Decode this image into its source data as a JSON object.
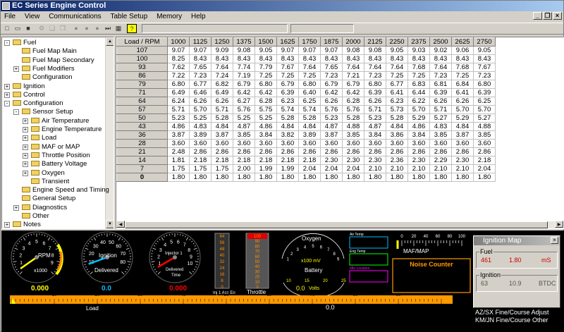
{
  "window": {
    "title": "EC Series Engine Control"
  },
  "menu": [
    "File",
    "View",
    "Communications",
    "Table Setup",
    "Memory",
    "Help"
  ],
  "tree": [
    {
      "label": "Fuel",
      "level": 0,
      "exp": "-"
    },
    {
      "label": "Fuel Map Main",
      "level": 1
    },
    {
      "label": "Fuel Map Secondary",
      "level": 1
    },
    {
      "label": "Fuel Modifiers",
      "level": 1,
      "exp": "+"
    },
    {
      "label": "Configuration",
      "level": 1
    },
    {
      "label": "Ignition",
      "level": 0,
      "exp": "+"
    },
    {
      "label": "Control",
      "level": 0,
      "exp": "+"
    },
    {
      "label": "Configuration",
      "level": 0,
      "exp": "-"
    },
    {
      "label": "Sensor Setup",
      "level": 1,
      "exp": "-"
    },
    {
      "label": "Air Temperature",
      "level": 2,
      "exp": "+"
    },
    {
      "label": "Engine Temperature",
      "level": 2,
      "exp": "+"
    },
    {
      "label": "Load",
      "level": 2,
      "exp": "+"
    },
    {
      "label": "MAF or MAP",
      "level": 2,
      "exp": "+"
    },
    {
      "label": "Throttle Position",
      "level": 2,
      "exp": "+"
    },
    {
      "label": "Battery Voltage",
      "level": 2,
      "exp": "+"
    },
    {
      "label": "Oxygen",
      "level": 2,
      "exp": "+"
    },
    {
      "label": "Transient",
      "level": 2
    },
    {
      "label": "Engine Speed and Timing",
      "level": 1
    },
    {
      "label": "General Setup",
      "level": 1
    },
    {
      "label": "Diagnostics",
      "level": 1,
      "exp": "+"
    },
    {
      "label": "Other",
      "level": 1
    },
    {
      "label": "Notes",
      "level": 0,
      "exp": "+"
    }
  ],
  "table": {
    "corner": "Load / RPM",
    "rpm": [
      "1000",
      "1125",
      "1250",
      "1375",
      "1500",
      "1625",
      "1750",
      "1875",
      "2000",
      "2125",
      "2250",
      "2375",
      "2500",
      "2625",
      "2750"
    ],
    "rows": [
      {
        "load": "107",
        "v": [
          "9.07",
          "9.07",
          "9.09",
          "9.08",
          "9.05",
          "9.07",
          "9.07",
          "9.07",
          "9.08",
          "9.08",
          "9.05",
          "9.03",
          "9.02",
          "9.06",
          "9.05"
        ]
      },
      {
        "load": "100",
        "v": [
          "8.25",
          "8.43",
          "8.43",
          "8.43",
          "8.43",
          "8.43",
          "8.43",
          "8.43",
          "8.43",
          "8.43",
          "8.43",
          "8.43",
          "8.43",
          "8.43",
          "8.43"
        ]
      },
      {
        "load": "93",
        "v": [
          "7.62",
          "7.65",
          "7.64",
          "7.74",
          "7.79",
          "7.67",
          "7.64",
          "7.65",
          "7.64",
          "7.64",
          "7.64",
          "7.68",
          "7.64",
          "7.68",
          "7.67"
        ]
      },
      {
        "load": "86",
        "v": [
          "7.22",
          "7.23",
          "7.24",
          "7.19",
          "7.25",
          "7.25",
          "7.25",
          "7.23",
          "7.21",
          "7.23",
          "7.25",
          "7.25",
          "7.23",
          "7.25",
          "7.23"
        ]
      },
      {
        "load": "79",
        "v": [
          "6.80",
          "6.77",
          "6.82",
          "6.79",
          "6.80",
          "6.79",
          "6.80",
          "6.79",
          "6.79",
          "6.80",
          "6.77",
          "6.83",
          "6.81",
          "6.84",
          "6.80"
        ]
      },
      {
        "load": "71",
        "v": [
          "6.49",
          "6.46",
          "6.49",
          "6.42",
          "6.42",
          "6.39",
          "6.40",
          "6.42",
          "6.42",
          "6.39",
          "6.41",
          "6.44",
          "6.39",
          "6.41",
          "6.39"
        ]
      },
      {
        "load": "64",
        "v": [
          "6.24",
          "6.26",
          "6.26",
          "6.27",
          "6.28",
          "6.23",
          "6.25",
          "6.26",
          "6.28",
          "6.26",
          "6.23",
          "6.22",
          "6.26",
          "6.26",
          "6.25"
        ]
      },
      {
        "load": "57",
        "v": [
          "5.71",
          "5.70",
          "5.71",
          "5.76",
          "5.75",
          "5.74",
          "5.74",
          "5.76",
          "5.76",
          "5.71",
          "5.73",
          "5.70",
          "5.71",
          "5.70",
          "5.70"
        ]
      },
      {
        "load": "50",
        "v": [
          "5.23",
          "5.25",
          "5.28",
          "5.25",
          "5.25",
          "5.28",
          "5.28",
          "5.23",
          "5.28",
          "5.23",
          "5.28",
          "5.29",
          "5.27",
          "5.29",
          "5.27"
        ]
      },
      {
        "load": "43",
        "v": [
          "4.86",
          "4.83",
          "4.84",
          "4.87",
          "4.86",
          "4.84",
          "4.84",
          "4.87",
          "4.88",
          "4.87",
          "4.84",
          "4.86",
          "4.83",
          "4.84",
          "4.88"
        ]
      },
      {
        "load": "36",
        "v": [
          "3.87",
          "3.89",
          "3.87",
          "3.85",
          "3.84",
          "3.82",
          "3.89",
          "3.87",
          "3.85",
          "3.84",
          "3.86",
          "3.84",
          "3.85",
          "3.87",
          "3.85"
        ]
      },
      {
        "load": "28",
        "v": [
          "3.60",
          "3.60",
          "3.60",
          "3.60",
          "3.60",
          "3.60",
          "3.60",
          "3.60",
          "3.60",
          "3.60",
          "3.60",
          "3.60",
          "3.60",
          "3.60",
          "3.60"
        ]
      },
      {
        "load": "21",
        "v": [
          "2.48",
          "2.86",
          "2.86",
          "2.86",
          "2.86",
          "2.86",
          "2.86",
          "2.86",
          "2.86",
          "2.86",
          "2.86",
          "2.86",
          "2.86",
          "2.86",
          "2.86"
        ]
      },
      {
        "load": "14",
        "v": [
          "1.81",
          "2.18",
          "2.18",
          "2.18",
          "2.18",
          "2.18",
          "2.18",
          "2.30",
          "2.30",
          "2.30",
          "2.36",
          "2.30",
          "2.29",
          "2.30",
          "2.18"
        ]
      },
      {
        "load": "7",
        "v": [
          "1.75",
          "1.75",
          "1.75",
          "2.00",
          "1.99",
          "1.99",
          "2.04",
          "2.04",
          "2.04",
          "2.10",
          "2.10",
          "2.10",
          "2.10",
          "2.10",
          "2.04"
        ]
      },
      {
        "load": "0",
        "v": [
          "1.80",
          "1.80",
          "1.80",
          "1.80",
          "1.80",
          "1.80",
          "1.80",
          "1.80",
          "1.80",
          "1.80",
          "1.80",
          "1.80",
          "1.80",
          "1.80",
          "1.80"
        ]
      }
    ]
  },
  "gauges": {
    "rpm": {
      "label": "RPM",
      "unit": "x1000",
      "value": "0.000",
      "ticks": [
        "1",
        "2",
        "3",
        "4",
        "5",
        "6",
        "7",
        "8",
        "9"
      ]
    },
    "ignition": {
      "label": "Ignition",
      "sub": "Delivered",
      "value": "0.0",
      "ticks": [
        "10",
        "20",
        "30",
        "40",
        "50",
        "60",
        "70",
        "80"
      ]
    },
    "injector": {
      "label": "Injector 1",
      "sub1": "Delivered",
      "sub2": "Time",
      "value": "0.000",
      "ticks": [
        "1",
        "2",
        "3",
        "4",
        "5",
        "6",
        "7",
        "8",
        "9",
        "10"
      ]
    },
    "accel": {
      "label": "Inj 1 Acc En",
      "ticks": [
        "64",
        "56",
        "48",
        "40",
        "32",
        "24",
        "16",
        "8",
        "0"
      ]
    },
    "throttle": {
      "label": "Throttle",
      "ticks": [
        "100",
        "90",
        "80",
        "70",
        "60",
        "50",
        "40",
        "30",
        "20",
        "10",
        "0"
      ]
    },
    "oxygen": {
      "label": "Oxygen",
      "unit": "x100 mV",
      "ticks": [
        "1",
        "2",
        "3",
        "4",
        "5",
        "6",
        "7",
        "8",
        "9"
      ]
    },
    "battery": {
      "label": "Battery",
      "unit": "Volts",
      "value": "0.0",
      "ticks": [
        "10",
        "15",
        "20",
        "25"
      ]
    },
    "airtemp": {
      "label": "Air Temp"
    },
    "engtemp": {
      "label": "Eng Temp"
    },
    "idle": {
      "label": "Idle Location"
    },
    "mafmap": {
      "label": "MAF/MAP",
      "ticks": [
        "0",
        "20",
        "40",
        "60",
        "80",
        "100"
      ]
    },
    "noise": {
      "label": "Noise Counter"
    },
    "load": {
      "label": "Load",
      "value": "0.0",
      "ticks": [
        "10",
        "20",
        "30",
        "40",
        "50",
        "60",
        "70",
        "80",
        "90"
      ]
    }
  },
  "ign_panel": {
    "title": "Ignition Map",
    "fuel_label": "Fuel",
    "fuel_vals": [
      "461",
      "1.80",
      "mS"
    ],
    "ign_label": "Ignition",
    "ign_vals": [
      "63",
      "10.9",
      "BTDC"
    ],
    "help1": "AZ/SX Fine/Course Adjust",
    "help2": "KM/JN Fine/Course Other"
  },
  "colors": {
    "accent": "#ff8c00",
    "yellow": "#ffff00",
    "cyan": "#00c0ff",
    "red": "#ff0000",
    "magenta": "#ff00ff",
    "orange_bar": "#ff9900"
  }
}
